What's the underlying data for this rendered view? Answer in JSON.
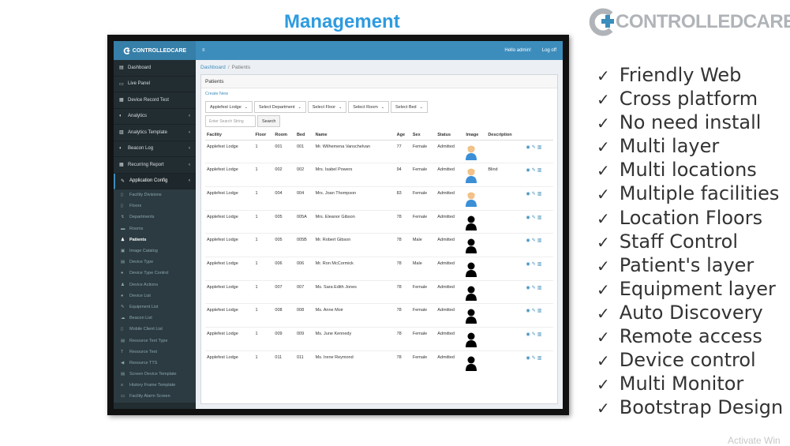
{
  "slide": {
    "title": "Management",
    "brand": {
      "word1": "CONTROLLED",
      "word2": "CARE"
    },
    "watermark": "Activate Win"
  },
  "app": {
    "logo": "CONTROLLEDCARE",
    "menu_icon": "≡",
    "greeting": "Hello admin!",
    "logout": "Log off",
    "sidebar": [
      {
        "icon": "▤",
        "label": "Dashboard",
        "arrow": ""
      },
      {
        "icon": "▭",
        "label": "Live Panel",
        "arrow": ""
      },
      {
        "icon": "▦",
        "label": "Device Record Test",
        "arrow": ""
      },
      {
        "icon": "◐",
        "label": "Analytics",
        "arrow": "‹"
      },
      {
        "icon": "▧",
        "label": "Analytics Template",
        "arrow": "‹"
      },
      {
        "icon": "◐",
        "label": "Beacon Log",
        "arrow": "‹"
      },
      {
        "icon": "▦",
        "label": "Recurring Report",
        "arrow": "‹"
      },
      {
        "icon": "✎",
        "label": "Application Config",
        "arrow": "‹"
      }
    ],
    "subitems": [
      {
        "icon": "▯",
        "label": "Facility Divisions"
      },
      {
        "icon": "▯",
        "label": "Floors"
      },
      {
        "icon": "↯",
        "label": "Departments"
      },
      {
        "icon": "▬",
        "label": "Rooms"
      },
      {
        "icon": "♟",
        "label": "Patients"
      },
      {
        "icon": "▣",
        "label": "Image Catalog"
      },
      {
        "icon": "▤",
        "label": "Device Type"
      },
      {
        "icon": "●",
        "label": "Device Type Control"
      },
      {
        "icon": "♟",
        "label": "Device Actions"
      },
      {
        "icon": "●",
        "label": "Device List"
      },
      {
        "icon": "✎",
        "label": "Equipment List"
      },
      {
        "icon": "☁",
        "label": "Beacon List"
      },
      {
        "icon": "▯",
        "label": "Mobile Client List"
      },
      {
        "icon": "▤",
        "label": "Resource Text Type"
      },
      {
        "icon": "T",
        "label": "Resource Text"
      },
      {
        "icon": "◀",
        "label": "Resource TTS"
      },
      {
        "icon": "▤",
        "label": "Screen Device Template"
      },
      {
        "icon": "≡",
        "label": "History Frame Template"
      },
      {
        "icon": "▭",
        "label": "Facility Alarm Screen"
      }
    ],
    "breadcrumb": {
      "home": "Dashboard",
      "current": "Patients"
    },
    "panel_title": "Patients",
    "create_new": "Create New",
    "filters": [
      "Applefest Lodge",
      "Select Department",
      "Select Floor",
      "Select Room",
      "Select Bed"
    ],
    "search_placeholder": "Enter Search String",
    "search_button": "Search",
    "columns": [
      "Facility",
      "Floor",
      "Room",
      "Bed",
      "Name",
      "Age",
      "Sex",
      "Status",
      "Image",
      "Description",
      ""
    ],
    "rows": [
      {
        "facility": "Applefest Lodge",
        "floor": "1",
        "room": "001",
        "bed": "001",
        "name": "Mr. Wilhemena Vanschelvan",
        "age": "77",
        "sex": "Female",
        "status": "Admitted",
        "image": "photo",
        "description": ""
      },
      {
        "facility": "Applefest Lodge",
        "floor": "1",
        "room": "002",
        "bed": "002",
        "name": "Mrs. Isabel Powers",
        "age": "94",
        "sex": "Female",
        "status": "Admitted",
        "image": "photo",
        "description": "Blind"
      },
      {
        "facility": "Applefest Lodge",
        "floor": "1",
        "room": "004",
        "bed": "004",
        "name": "Mrs. Joan Thompson",
        "age": "83",
        "sex": "Female",
        "status": "Admitted",
        "image": "photo",
        "description": ""
      },
      {
        "facility": "Applefest Lodge",
        "floor": "1",
        "room": "005",
        "bed": "005A",
        "name": "Mrs. Eleanor Gibson",
        "age": "78",
        "sex": "Female",
        "status": "Admitted",
        "image": "silhouette",
        "description": ""
      },
      {
        "facility": "Applefest Lodge",
        "floor": "1",
        "room": "005",
        "bed": "005B",
        "name": "Mr. Robert Gibson",
        "age": "78",
        "sex": "Male",
        "status": "Admitted",
        "image": "silhouette",
        "description": ""
      },
      {
        "facility": "Applefest Lodge",
        "floor": "1",
        "room": "006",
        "bed": "006",
        "name": "Mr. Ron McCormick",
        "age": "78",
        "sex": "Male",
        "status": "Admitted",
        "image": "silhouette",
        "description": ""
      },
      {
        "facility": "Applefest Lodge",
        "floor": "1",
        "room": "007",
        "bed": "007",
        "name": "Ms. Sara Edith Jones",
        "age": "78",
        "sex": "Female",
        "status": "Admitted",
        "image": "silhouette",
        "description": ""
      },
      {
        "facility": "Applefest Lodge",
        "floor": "1",
        "room": "008",
        "bed": "008",
        "name": "Ms. Anne Moir",
        "age": "78",
        "sex": "Female",
        "status": "Admitted",
        "image": "silhouette",
        "description": ""
      },
      {
        "facility": "Applefest Lodge",
        "floor": "1",
        "room": "009",
        "bed": "009",
        "name": "Ms. June Kennedy",
        "age": "78",
        "sex": "Female",
        "status": "Admitted",
        "image": "silhouette",
        "description": ""
      },
      {
        "facility": "Applefest Lodge",
        "floor": "1",
        "room": "011",
        "bed": "011",
        "name": "Ms. Irene Reymond",
        "age": "78",
        "sex": "Female",
        "status": "Admitted",
        "image": "silhouette",
        "description": ""
      }
    ],
    "actions": {
      "view": "◉",
      "edit": "✎",
      "delete": "▥"
    }
  },
  "features": {
    "tick": "✓",
    "items": [
      "Friendly Web",
      "Cross platform",
      "No need install",
      "Multi layer",
      "Multi locations",
      "Multiple facilities",
      "Location Floors",
      "Staff Control",
      "Patient's layer",
      "Equipment layer",
      "Auto Discovery",
      "Remote access",
      "Device control",
      "Multi Monitor",
      "Bootstrap Design"
    ]
  },
  "colors": {
    "title": "#2e9be0",
    "topbar": "#3c8dbc",
    "sidebar": "#222d32",
    "brand_grey": "#b0b4b8"
  }
}
